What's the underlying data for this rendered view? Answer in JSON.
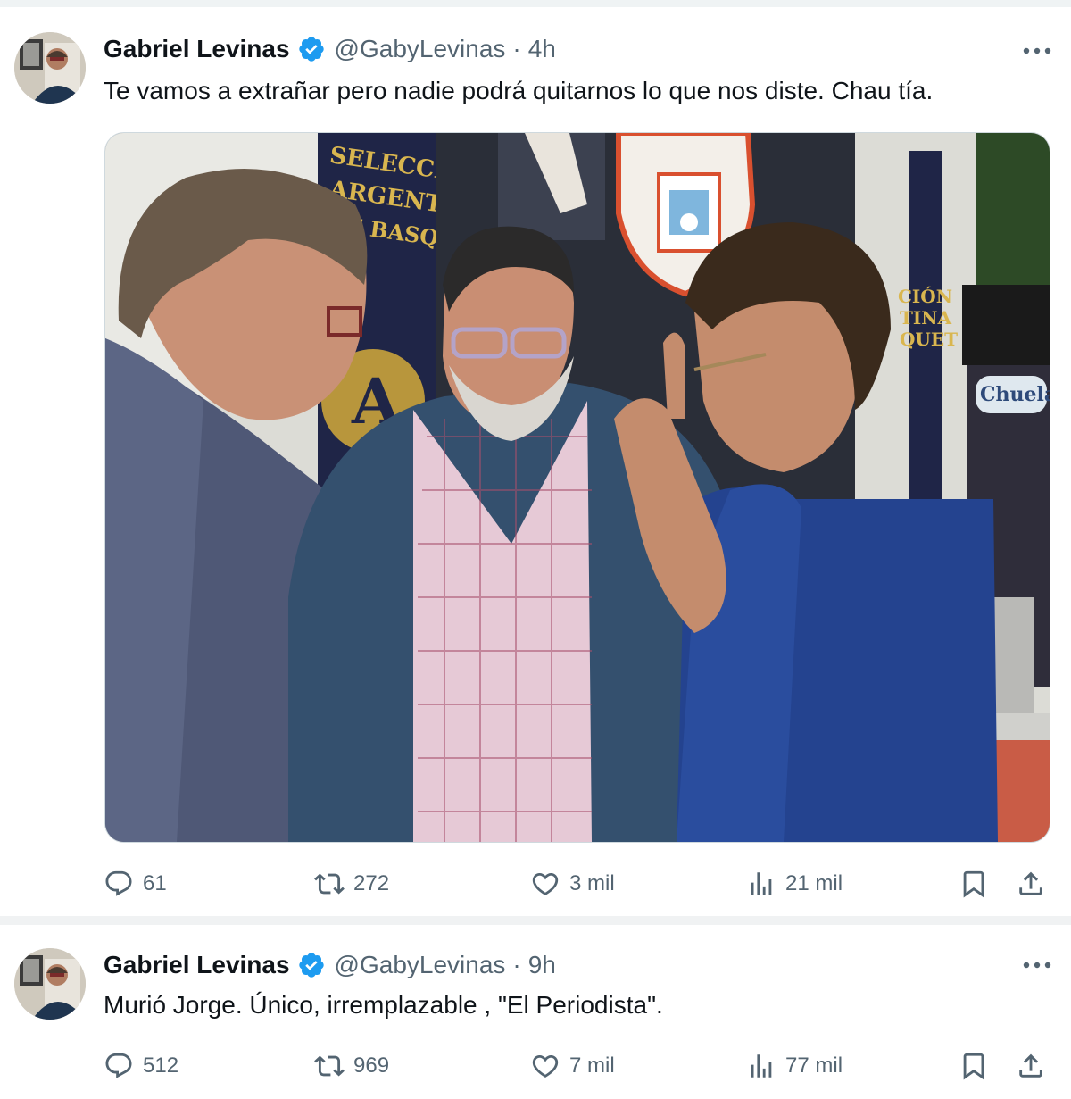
{
  "tweets": [
    {
      "author_name": "Gabriel Levinas",
      "handle": "@GabyLevinas",
      "separator": "·",
      "time": "4h",
      "text": "Te vamos a extrañar pero nadie podrá quitarnos lo que nos diste. Chau tía.",
      "media_text": {
        "banner_line1": "SELECCIÓN",
        "banner_line2": "ARGENTINA",
        "banner_line3": "DE BASQUET",
        "right_banner": "CIÓN\nTINA\nQUET",
        "shop_sign": "Chuela"
      },
      "actions": {
        "replies": "61",
        "reposts": "272",
        "likes": "3 mil",
        "views": "21 mil"
      }
    },
    {
      "author_name": "Gabriel Levinas",
      "handle": "@GabyLevinas",
      "separator": "·",
      "time": "9h",
      "text": "Murió Jorge. Único, irremplazable , \"El Periodista\".",
      "actions": {
        "replies": "512",
        "reposts": "969",
        "likes": "7 mil",
        "views": "77 mil"
      }
    }
  ],
  "icons": {
    "verified": "verified-badge-icon",
    "more": "more-icon",
    "reply": "reply-icon",
    "repost": "repost-icon",
    "like": "heart-icon",
    "views": "views-icon",
    "bookmark": "bookmark-icon",
    "share": "share-icon"
  },
  "colors": {
    "verified_blue": "#1d9bf0",
    "text_primary": "#0f1419",
    "text_secondary": "#536471"
  }
}
